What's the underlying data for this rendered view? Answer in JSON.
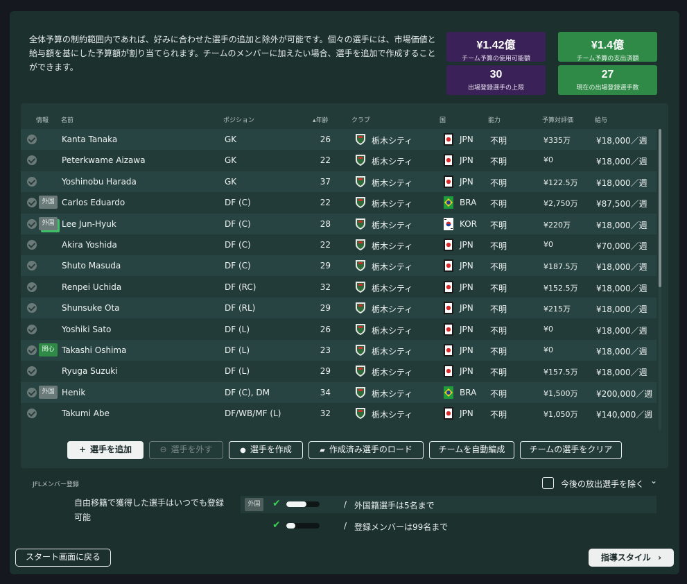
{
  "intro_text": "全体予算の制約範囲内であれば、好みに合わせた選手の追加と除外が可能です。個々の選手には、市場価値と給与額を基にした予算額が割り当てられます。チームのメンバーに加えたい場合、選手を追加で作成することができます。",
  "stats": {
    "budget_available": {
      "value": "¥1.42億",
      "label": "チーム予算の使用可能額"
    },
    "budget_spent": {
      "value": "¥1.4億",
      "label": "チーム予算の支出済額"
    },
    "max_players": {
      "value": "30",
      "label": "出場登録選手の上限"
    },
    "current_players": {
      "value": "27",
      "label": "現在の出場登録選手数"
    }
  },
  "table": {
    "headers": {
      "info": "情報",
      "name": "名前",
      "position": "ポジション",
      "age": "▴年齢",
      "club": "クラブ",
      "nation": "国",
      "ability": "能力",
      "budget": "予算対評価",
      "wage": "給与"
    },
    "rows": [
      {
        "name": "Kanta Tanaka",
        "position": "GK",
        "age": "26",
        "club": "栃木シティ",
        "nation": "JPN",
        "ability": "不明",
        "budget": "¥335万",
        "wage": "¥18,000／週",
        "badge": ""
      },
      {
        "name": "Peterkwame Aizawa",
        "position": "GK",
        "age": "22",
        "club": "栃木シティ",
        "nation": "JPN",
        "ability": "不明",
        "budget": "¥0",
        "wage": "¥18,000／週",
        "badge": ""
      },
      {
        "name": "Yoshinobu Harada",
        "position": "GK",
        "age": "37",
        "club": "栃木シティ",
        "nation": "JPN",
        "ability": "不明",
        "budget": "¥122.5万",
        "wage": "¥18,000／週",
        "badge": ""
      },
      {
        "name": "Carlos Eduardo",
        "position": "DF (C)",
        "age": "22",
        "club": "栃木シティ",
        "nation": "BRA",
        "ability": "不明",
        "budget": "¥2,750万",
        "wage": "¥87,500／週",
        "badge": "外国"
      },
      {
        "name": "Lee Jun-Hyuk",
        "position": "DF (C)",
        "age": "28",
        "club": "栃木シティ",
        "nation": "KOR",
        "ability": "不明",
        "budget": "¥220万",
        "wage": "¥18,000／週",
        "badge": "外国"
      },
      {
        "name": "Akira Yoshida",
        "position": "DF (C)",
        "age": "22",
        "club": "栃木シティ",
        "nation": "JPN",
        "ability": "不明",
        "budget": "¥0",
        "wage": "¥70,000／週",
        "badge": ""
      },
      {
        "name": "Shuto Masuda",
        "position": "DF (C)",
        "age": "29",
        "club": "栃木シティ",
        "nation": "JPN",
        "ability": "不明",
        "budget": "¥187.5万",
        "wage": "¥18,000／週",
        "badge": ""
      },
      {
        "name": "Renpei Uchida",
        "position": "DF (RC)",
        "age": "32",
        "club": "栃木シティ",
        "nation": "JPN",
        "ability": "不明",
        "budget": "¥152.5万",
        "wage": "¥18,000／週",
        "badge": ""
      },
      {
        "name": "Shunsuke Ota",
        "position": "DF (RL)",
        "age": "29",
        "club": "栃木シティ",
        "nation": "JPN",
        "ability": "不明",
        "budget": "¥215万",
        "wage": "¥18,000／週",
        "badge": ""
      },
      {
        "name": "Yoshiki Sato",
        "position": "DF (L)",
        "age": "26",
        "club": "栃木シティ",
        "nation": "JPN",
        "ability": "不明",
        "budget": "¥0",
        "wage": "¥18,000／週",
        "badge": ""
      },
      {
        "name": "Takashi Oshima",
        "position": "DF (L)",
        "age": "23",
        "club": "栃木シティ",
        "nation": "JPN",
        "ability": "不明",
        "budget": "¥0",
        "wage": "¥18,000／週",
        "badge": "関心"
      },
      {
        "name": "Ryuga Suzuki",
        "position": "DF (L)",
        "age": "29",
        "club": "栃木シティ",
        "nation": "JPN",
        "ability": "不明",
        "budget": "¥157.5万",
        "wage": "¥18,000／週",
        "badge": ""
      },
      {
        "name": "Henik",
        "position": "DF (C), DM",
        "age": "34",
        "club": "栃木シティ",
        "nation": "BRA",
        "ability": "不明",
        "budget": "¥1,500万",
        "wage": "¥200,000／週",
        "badge": "外国"
      },
      {
        "name": "Takumi Abe",
        "position": "DF/WB/MF (L)",
        "age": "32",
        "club": "栃木シティ",
        "nation": "JPN",
        "ability": "不明",
        "budget": "¥1,050万",
        "wage": "¥140,000／週",
        "badge": ""
      }
    ]
  },
  "buttons": {
    "add": "選手を追加",
    "remove": "選手を外す",
    "create": "選手を作成",
    "load": "作成済み選手のロード",
    "auto": "チームを自動編成",
    "clear": "チームの選手をクリア"
  },
  "registration": {
    "title": "JFLメンバー登録",
    "exclude_label": "今後の放出選手を除く",
    "note": "自由移籍で獲得した選手はいつでも登録可能",
    "foreign_tag": "外国",
    "rule1": "外国籍選手は5名まで",
    "rule1_progress": 0.6,
    "rule2": "登録メンバーは99名まで",
    "rule2_progress": 0.27,
    "slash": "/"
  },
  "footer": {
    "back": "スタート画面に戻る",
    "coach": "指導スタイル"
  },
  "colors": {
    "purple_stat": "#3a2157",
    "green_stat": "#2f8a47",
    "panel": "#1c302e",
    "check": "#3ccf56"
  }
}
